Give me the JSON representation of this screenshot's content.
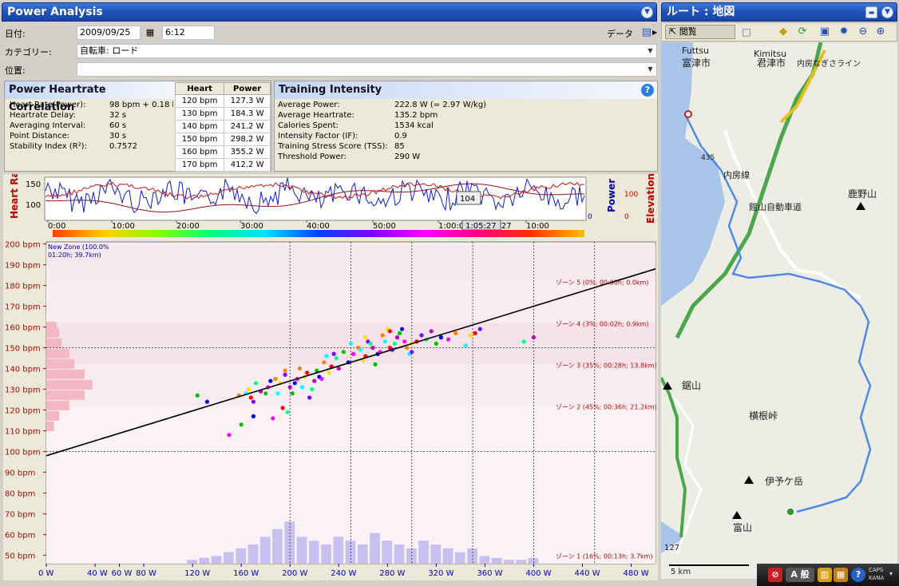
{
  "left_panel": {
    "title": "Power Analysis"
  },
  "form": {
    "date_label": "日付:",
    "date_value": "2009/09/25",
    "time_value": "6:12",
    "data_label": "データ",
    "category_label": "カテゴリー:",
    "category_value": "自転車: ロード",
    "location_label": "位置:",
    "location_value": ""
  },
  "correlation": {
    "title": "Power Heartrate Correlation",
    "rows": [
      {
        "label": "Heart Rate(Power):",
        "value": "98 bpm + 0.18 b"
      },
      {
        "label": "Heartrate Delay:",
        "value": "32 s"
      },
      {
        "label": "Averaging Interval:",
        "value": "60 s"
      },
      {
        "label": "Point Distance:",
        "value": "30 s"
      },
      {
        "label": "Stability Index (R²):",
        "value": "0.7572"
      }
    ],
    "table_headers": [
      "Heart",
      "Power"
    ],
    "table_rows": [
      [
        "120 bpm",
        "127.3 W"
      ],
      [
        "130 bpm",
        "184.3 W"
      ],
      [
        "140 bpm",
        "241.2 W"
      ],
      [
        "150 bpm",
        "298.2 W"
      ],
      [
        "160 bpm",
        "355.2 W"
      ],
      [
        "170 bpm",
        "412.2 W"
      ]
    ]
  },
  "intensity": {
    "title": "Training Intensity",
    "rows": [
      {
        "label": "Average Power:",
        "value": "222.8 W (= 2.97 W/kg)"
      },
      {
        "label": "Average Heartrate:",
        "value": "135.2 bpm"
      },
      {
        "label": "Calories Spent:",
        "value": "1534 kcal"
      },
      {
        "label": "Intensity Factor (IF):",
        "value": "0.9"
      },
      {
        "label": "Training Stress Score (TSS):",
        "value": "85"
      },
      {
        "label": "Threshold Power:",
        "value": "290 W"
      }
    ]
  },
  "timeline": {
    "left_axis_label": "Heart Rate",
    "right_axis_label_power": "Power",
    "right_axis_label_elev": "Elevation",
    "left_ticks": [
      "150",
      "100"
    ],
    "right_ticks": [
      "100",
      "0"
    ],
    "right_ticks_elev": [
      "100",
      "0"
    ],
    "time_ticks": [
      "0:00",
      "10:00",
      "20:00",
      "30:00",
      "40:00",
      "50:00",
      "1:00:00",
      "1:05:27",
      "10:00"
    ],
    "cursor_value": "104",
    "cursor_time": "1:05:27"
  },
  "chart_data": {
    "type": "scatter",
    "title": "",
    "xlabel": "",
    "ylabel": "",
    "xlim": [
      0,
      500
    ],
    "ylim": [
      46,
      201
    ],
    "y_ticks": [
      "200 bpm",
      "190 bpm",
      "180 bpm",
      "170 bpm",
      "160 bpm",
      "150 bpm",
      "140 bpm",
      "130 bpm",
      "120 bpm",
      "110 bpm",
      "100 bpm",
      "90 bpm",
      "80 bpm",
      "70 bpm",
      "60 bpm",
      "50 bpm"
    ],
    "x_ticks": [
      "0 W",
      "40 W",
      "60 W",
      "80 W",
      "120 W",
      "160 W",
      "200 W",
      "240 W",
      "280 W",
      "320 W",
      "360 W",
      "400 W",
      "440 W",
      "480 W"
    ],
    "regression": {
      "intercept": 98,
      "slope": 0.18
    },
    "zone_annotation_topleft": [
      "New Zone (100.0%",
      "01:20h; 39.7km)"
    ],
    "zones": [
      {
        "label": "ゾーン 5 (0%; 00:00h; 0.0km)",
        "hr": 182
      },
      {
        "label": "ゾーン 4 (3%; 00:02h; 0.9km)",
        "hr": 162
      },
      {
        "label": "ゾーン 3 (35%; 00:28h; 13.8km)",
        "hr": 142
      },
      {
        "label": "ゾーン 2 (45%; 00:36h; 21.2km)",
        "hr": 122
      },
      {
        "label": "ゾーン 1 (16%; 00:13h; 3.7km)",
        "hr": 50
      }
    ],
    "points": [
      [
        124,
        127
      ],
      [
        132,
        124
      ],
      [
        150,
        108
      ],
      [
        158,
        127
      ],
      [
        164,
        128
      ],
      [
        166,
        130
      ],
      [
        168,
        126
      ],
      [
        170,
        124
      ],
      [
        172,
        133
      ],
      [
        176,
        129
      ],
      [
        180,
        128
      ],
      [
        184,
        134
      ],
      [
        186,
        116
      ],
      [
        188,
        135
      ],
      [
        190,
        128
      ],
      [
        192,
        133
      ],
      [
        194,
        121
      ],
      [
        196,
        137
      ],
      [
        198,
        119
      ],
      [
        200,
        131
      ],
      [
        202,
        128
      ],
      [
        204,
        133
      ],
      [
        206,
        135
      ],
      [
        208,
        140
      ],
      [
        210,
        131
      ],
      [
        212,
        136
      ],
      [
        214,
        138
      ],
      [
        216,
        126
      ],
      [
        218,
        130
      ],
      [
        220,
        134
      ],
      [
        222,
        139
      ],
      [
        224,
        136
      ],
      [
        226,
        135
      ],
      [
        228,
        143
      ],
      [
        230,
        146
      ],
      [
        232,
        138
      ],
      [
        234,
        141
      ],
      [
        236,
        147
      ],
      [
        238,
        145
      ],
      [
        240,
        140
      ],
      [
        244,
        148
      ],
      [
        248,
        143
      ],
      [
        252,
        147
      ],
      [
        256,
        150
      ],
      [
        258,
        149
      ],
      [
        260,
        144
      ],
      [
        262,
        146
      ],
      [
        264,
        153
      ],
      [
        266,
        152
      ],
      [
        268,
        150
      ],
      [
        270,
        142
      ],
      [
        272,
        147
      ],
      [
        274,
        148
      ],
      [
        276,
        156
      ],
      [
        278,
        153
      ],
      [
        280,
        159
      ],
      [
        282,
        150
      ],
      [
        284,
        149
      ],
      [
        286,
        152
      ],
      [
        288,
        155
      ],
      [
        290,
        157
      ],
      [
        292,
        159
      ],
      [
        294,
        153
      ],
      [
        296,
        150
      ],
      [
        298,
        147
      ],
      [
        300,
        152
      ],
      [
        304,
        153
      ],
      [
        308,
        156
      ],
      [
        312,
        154
      ],
      [
        316,
        158
      ],
      [
        320,
        152
      ],
      [
        324,
        155
      ],
      [
        330,
        154
      ],
      [
        336,
        157
      ],
      [
        344,
        151
      ],
      [
        348,
        156
      ],
      [
        352,
        157
      ],
      [
        356,
        159
      ],
      [
        392,
        153
      ],
      [
        400,
        155
      ],
      [
        160,
        113
      ],
      [
        170,
        117
      ],
      [
        182,
        131
      ],
      [
        196,
        139
      ],
      [
        250,
        152
      ],
      [
        262,
        155
      ],
      [
        282,
        158
      ],
      [
        300,
        148
      ]
    ],
    "hr_histogram": [
      [
        160,
        8
      ],
      [
        157,
        10
      ],
      [
        152,
        12
      ],
      [
        147,
        18
      ],
      [
        142,
        22
      ],
      [
        137,
        30
      ],
      [
        132,
        36
      ],
      [
        127,
        30
      ],
      [
        122,
        18
      ],
      [
        117,
        10
      ],
      [
        112,
        6
      ]
    ],
    "power_histogram": [
      [
        120,
        2
      ],
      [
        130,
        3
      ],
      [
        140,
        4
      ],
      [
        150,
        6
      ],
      [
        160,
        8
      ],
      [
        170,
        10
      ],
      [
        180,
        14
      ],
      [
        190,
        18
      ],
      [
        200,
        22
      ],
      [
        210,
        14
      ],
      [
        220,
        12
      ],
      [
        230,
        10
      ],
      [
        240,
        14
      ],
      [
        250,
        12
      ],
      [
        260,
        10
      ],
      [
        270,
        16
      ],
      [
        280,
        12
      ],
      [
        290,
        10
      ],
      [
        300,
        8
      ],
      [
        310,
        12
      ],
      [
        320,
        10
      ],
      [
        330,
        8
      ],
      [
        340,
        6
      ],
      [
        350,
        8
      ],
      [
        360,
        4
      ],
      [
        370,
        3
      ],
      [
        380,
        2
      ],
      [
        390,
        2
      ],
      [
        400,
        3
      ]
    ]
  },
  "map_panel": {
    "title": "ルート : 地図",
    "tool_browse": "閲覧",
    "labels": [
      "Kimitsu",
      "君津市",
      "Futtsu",
      "富津市",
      "鹿野山",
      "鋸山",
      "横根峠",
      "伊予ケ岳",
      "富山",
      "5 km",
      "435",
      "127",
      "館山自動車道",
      "内房線",
      "内房なぎさライン"
    ]
  },
  "tray": {
    "caps": "CAPS",
    "kana": "KANA",
    "ime": "A 般"
  }
}
